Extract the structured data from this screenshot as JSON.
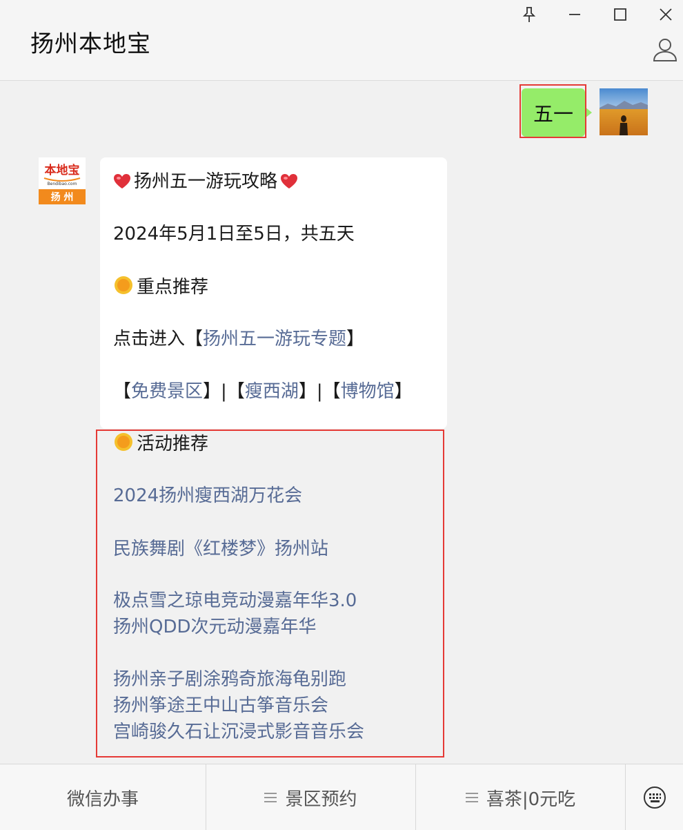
{
  "header": {
    "title": "扬州本地宝",
    "buttons": [
      "pin-icon",
      "minimize-icon",
      "maximize-icon",
      "close-icon"
    ],
    "profile_icon": "person-icon"
  },
  "chat": {
    "user_message": "五一",
    "bot_avatar": {
      "brand": "本地宝",
      "sub": "Bendibao.com",
      "city": "扬 州"
    },
    "bot_message": {
      "title": "扬州五一游玩攻略",
      "dates": "2024年5月1日至5日，共五天",
      "section1_title": "重点推荐",
      "click_prefix": "点击进入【",
      "topic_link": "扬州五一游玩专题",
      "click_suffix": "】",
      "quick_links": [
        "免费景区",
        "瘦西湖",
        "博物馆"
      ],
      "bracket_open": "【",
      "bracket_close": "】",
      "separator": "|",
      "section2_title": "活动推荐",
      "activities": [
        "2024扬州瘦西湖万花会",
        "民族舞剧《红楼梦》扬州站",
        "极点雪之琼电竞动漫嘉年华3.0",
        "扬州QDD次元动漫嘉年华",
        "扬州亲子剧涂鸦奇旅海龟别跑",
        "扬州筝途王中山古筝音乐会",
        "宫崎骏久石让沉浸式影音音乐会"
      ]
    }
  },
  "bottom_menu": {
    "items": [
      "微信办事",
      "景区预约",
      "喜茶|0元吃"
    ],
    "keyboard_icon": "keyboard-icon"
  },
  "colors": {
    "link": "#576b95",
    "user_bubble": "#95ec69",
    "highlight_border": "#e53935",
    "logo_red": "#d92b1c",
    "logo_orange": "#f28a1d"
  }
}
